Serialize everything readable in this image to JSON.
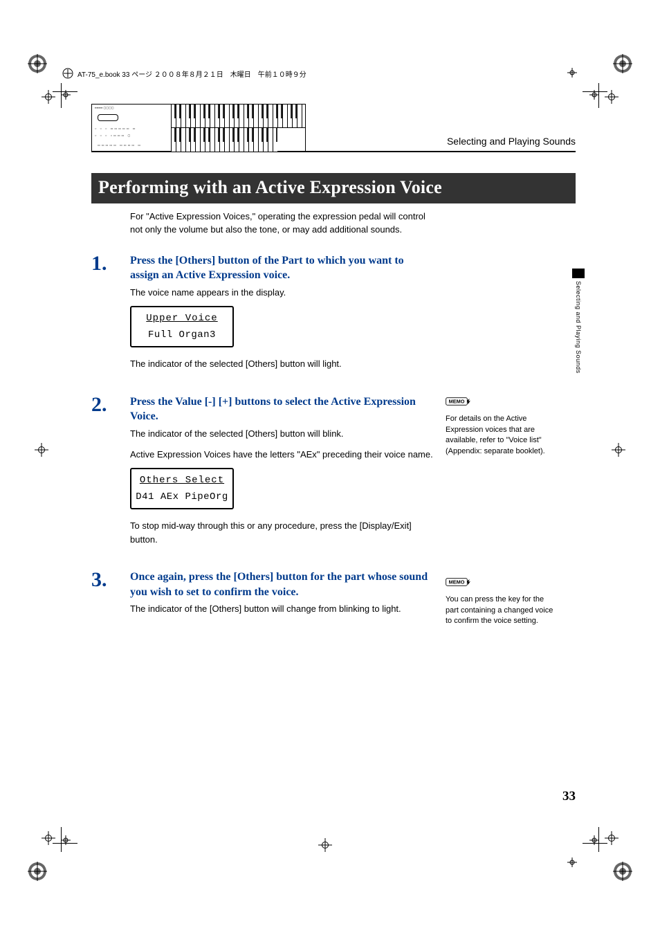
{
  "header_info": "AT-75_e.book 33 ページ ２００８年８月２１日　木曜日　午前１０時９分",
  "chapter_title": "Selecting and Playing Sounds",
  "section_title": "Performing with an Active Expression Voice",
  "intro_text": "For \"Active Expression Voices,\" operating the expression pedal will control not only the volume but also the tone, or may add additional sounds.",
  "steps": [
    {
      "num": "1.",
      "title": "Press the [Others] button of the Part to which you want to assign an Active Expression voice.",
      "texts": [
        "The voice name appears in the display."
      ],
      "lcd": {
        "line1": "Upper Voice",
        "line2": "Full Organ3"
      },
      "after_texts": [
        "The indicator of the selected [Others] button will light."
      ]
    },
    {
      "num": "2.",
      "title": "Press the Value [-] [+] buttons to select the Active Expression Voice.",
      "texts": [
        "The indicator of the selected [Others] button will blink.",
        "Active Expression Voices have the letters \"AEx\" preceding their voice name."
      ],
      "lcd": {
        "line1": "Others Select",
        "line2": "D41  AEx PipeOrg"
      },
      "after_texts": [
        "To stop mid-way through this or any procedure, press the [Display/Exit] button."
      ]
    },
    {
      "num": "3.",
      "title": "Once again, press the [Others] button for the part whose sound you wish to set to confirm the voice.",
      "texts": [
        "The indicator of the [Others] button will change from blinking to light."
      ],
      "lcd": null,
      "after_texts": []
    }
  ],
  "memos": [
    {
      "text": "For details on the Active Expression voices that are available, refer to \"Voice list\" (Appendix: separate booklet)."
    },
    {
      "text": "You can press the key for the part containing a changed voice to confirm the voice setting."
    }
  ],
  "side_tab_label": "Selecting and Playing Sounds",
  "page_number": "33",
  "memo_label": "MEMO"
}
